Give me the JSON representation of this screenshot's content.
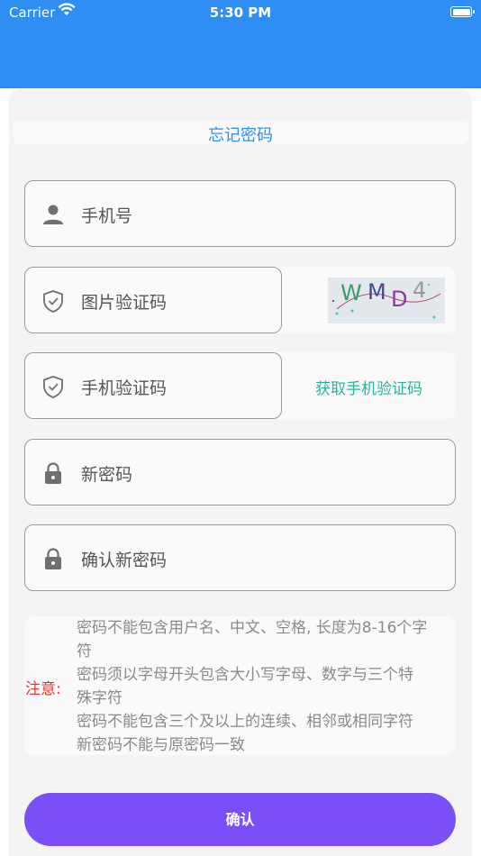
{
  "status_bar": {
    "carrier": "Carrier",
    "time": "5:30 PM"
  },
  "page": {
    "title": "忘记密码"
  },
  "form": {
    "phone_placeholder": "手机号",
    "image_code_placeholder": "图片验证码",
    "sms_code_placeholder": "手机验证码",
    "get_sms_code_label": "获取手机验证码",
    "new_password_placeholder": "新密码",
    "confirm_password_placeholder": "确认新密码",
    "captcha_text": [
      "W",
      "M",
      "D",
      "4"
    ]
  },
  "notice": {
    "label": "注意:",
    "lines": [
      "密码不能包含用户名、中文、空格, 长度为8-16个字",
      "符",
      "密码须以字母开头包含大小写字母、数字与三个特",
      "殊字符",
      "密码不能包含三个及以上的连续、相邻或相同字符",
      "新密码不能与原密码一致"
    ]
  },
  "confirm_button": {
    "label": "确认"
  },
  "colors": {
    "header": "#2f8ef3",
    "accent_link": "#25b5a3",
    "button": "#7a4ff7",
    "notice": "#e53935"
  }
}
